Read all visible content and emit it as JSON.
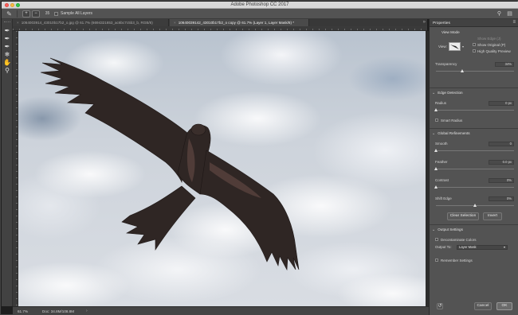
{
  "window": {
    "title": "Adobe Photoshop CC 2017"
  },
  "options_bar": {
    "sample_all_layers_label": "Sample All Layers",
    "brush_size_value": "35"
  },
  "tabs": [
    {
      "label": "1064003914_43010b17b2_o.jpg @ 61.7% (6694321653_ac6bc7c5b3_b, RGB/8)",
      "active": false
    },
    {
      "label": "10640039142_43010b17b2_o copy @ 61.7% (Layer 1, Layer Mask/8) *",
      "active": true
    }
  ],
  "status": {
    "zoom": "61.7%",
    "doc": "Doc: 34.8M/108.8M"
  },
  "properties": {
    "title": "Properties",
    "view_mode": {
      "section": "View Mode",
      "view_label": "View:",
      "show_edge": "Show Edge (J)",
      "show_original": "Show Original (P)",
      "high_quality": "High Quality Preview",
      "transparency_label": "Transparency",
      "transparency_value": "34%",
      "transparency_fraction": 0.34
    },
    "edge_detection": {
      "section": "Edge Detection",
      "radius_label": "Radius",
      "radius_value": "0 px",
      "radius_fraction": 0.0,
      "smart_radius": "Smart Radius"
    },
    "global_refinements": {
      "section": "Global Refinements",
      "smooth_label": "Smooth",
      "smooth_value": "0",
      "feather_label": "Feather",
      "feather_value": "0.0 px",
      "contrast_label": "Contrast",
      "contrast_value": "0%",
      "shift_edge_label": "Shift Edge",
      "shift_edge_value": "0%",
      "shift_edge_fraction": 0.5,
      "clear_selection": "Clear Selection",
      "invert": "Invert"
    },
    "output_settings": {
      "section": "Output Settings",
      "decontaminate": "Decontaminate Colors",
      "output_to_label": "Output To:",
      "output_to_value": "Layer Mask",
      "remember": "Remember Settings"
    },
    "cancel": "Cancel",
    "ok": "OK"
  }
}
